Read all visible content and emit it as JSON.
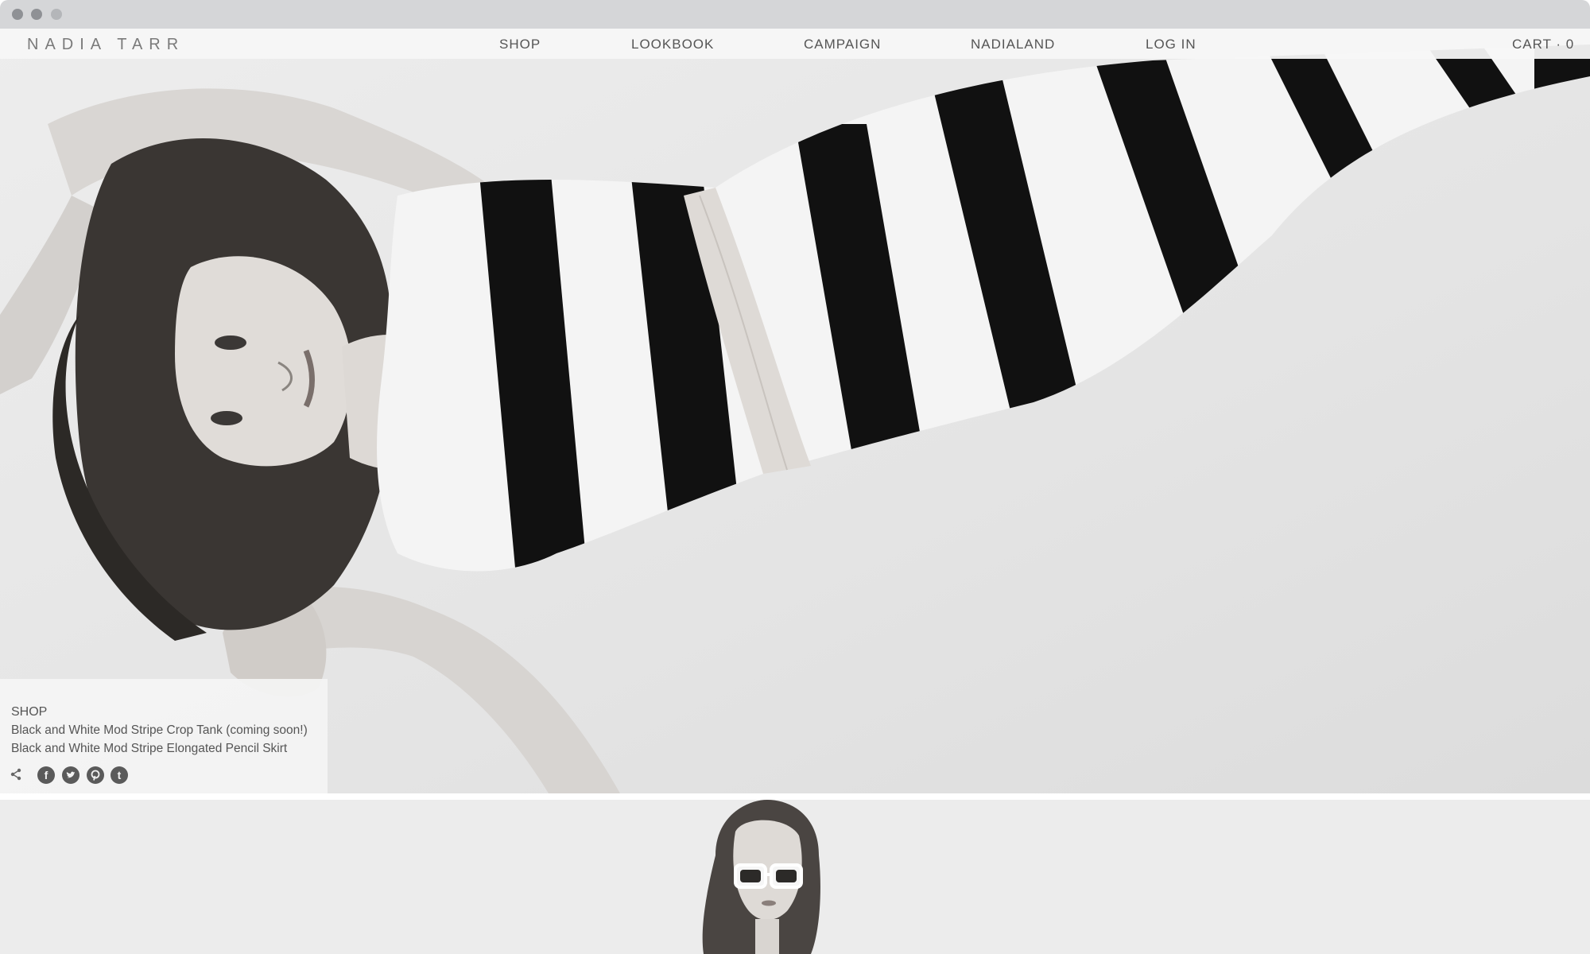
{
  "brand": {
    "logo": "NADIA TARR"
  },
  "nav": {
    "items": [
      {
        "label": "SHOP"
      },
      {
        "label": "LOOKBOOK"
      },
      {
        "label": "CAMPAIGN"
      },
      {
        "label": "NADIALAND"
      },
      {
        "label": "LOG IN"
      }
    ],
    "cart_label": "CART · 0"
  },
  "caption": {
    "title": "SHOP",
    "items": [
      {
        "label": "Black and White Mod Stripe Crop Tank (coming soon!)"
      },
      {
        "label": "Black and White Mod Stripe Elongated Pencil Skirt"
      }
    ]
  },
  "social": {
    "icons": [
      "share-icon",
      "facebook-icon",
      "twitter-icon",
      "pinterest-icon",
      "tumblr-icon"
    ]
  },
  "colors": {
    "stripe_black": "#111111",
    "stripe_white": "#f4f4f4",
    "background": "#e6e6e6"
  }
}
